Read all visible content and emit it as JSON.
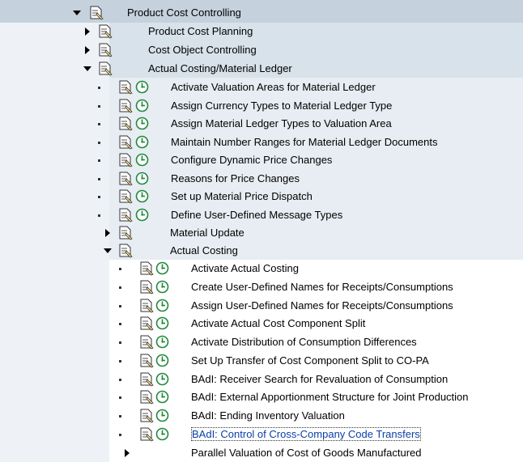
{
  "tree": {
    "root": {
      "label": "Product Cost Controlling"
    },
    "level1": [
      {
        "label": "Product Cost Planning"
      },
      {
        "label": "Cost Object Controlling"
      },
      {
        "label": "Actual Costing/Material Ledger"
      }
    ],
    "ml_activities": [
      {
        "label": "Activate Valuation Areas for Material Ledger"
      },
      {
        "label": "Assign Currency Types to Material Ledger Type"
      },
      {
        "label": "Assign Material Ledger Types to Valuation Area"
      },
      {
        "label": "Maintain Number Ranges for Material Ledger Documents"
      },
      {
        "label": "Configure Dynamic Price Changes"
      },
      {
        "label": "Reasons for Price Changes"
      },
      {
        "label": "Set up Material Price Dispatch"
      },
      {
        "label": "Define User-Defined Message Types"
      }
    ],
    "material_update": {
      "label": "Material Update"
    },
    "actual_costing": {
      "label": "Actual Costing"
    },
    "ac_activities": [
      {
        "label": "Activate Actual Costing"
      },
      {
        "label": "Create User-Defined Names for Receipts/Consumptions"
      },
      {
        "label": "Assign User-Defined Names for Receipts/Consumptions"
      },
      {
        "label": "Activate Actual Cost Component Split"
      },
      {
        "label": "Activate Distribution of Consumption Differences"
      },
      {
        "label": "Set Up Transfer of Cost Component Split to CO-PA"
      },
      {
        "label": "BAdI: Receiver Search for Revaluation of Consumption"
      },
      {
        "label": "BAdI: External Apportionment Structure for Joint Production"
      },
      {
        "label": "BAdI: Ending Inventory Valuation"
      },
      {
        "label": "BAdI: Control of Cross-Company Code Transfers"
      }
    ],
    "parallel_valuation": {
      "label": "Parallel Valuation of Cost of Goods Manufactured"
    }
  },
  "colors": {
    "band_level0": "#c5d2dd",
    "band_level1": "#d8e2ea",
    "band_level2": "#e7edf2",
    "band_left": "#eef2f7",
    "selected_text": "#0b3fa8",
    "clock_green": "#1f8a3c"
  },
  "icons": {
    "expanded": "triangle-down-icon",
    "collapsed": "triangle-right-icon",
    "document": "document-icon",
    "execute": "execute-clock-icon"
  }
}
